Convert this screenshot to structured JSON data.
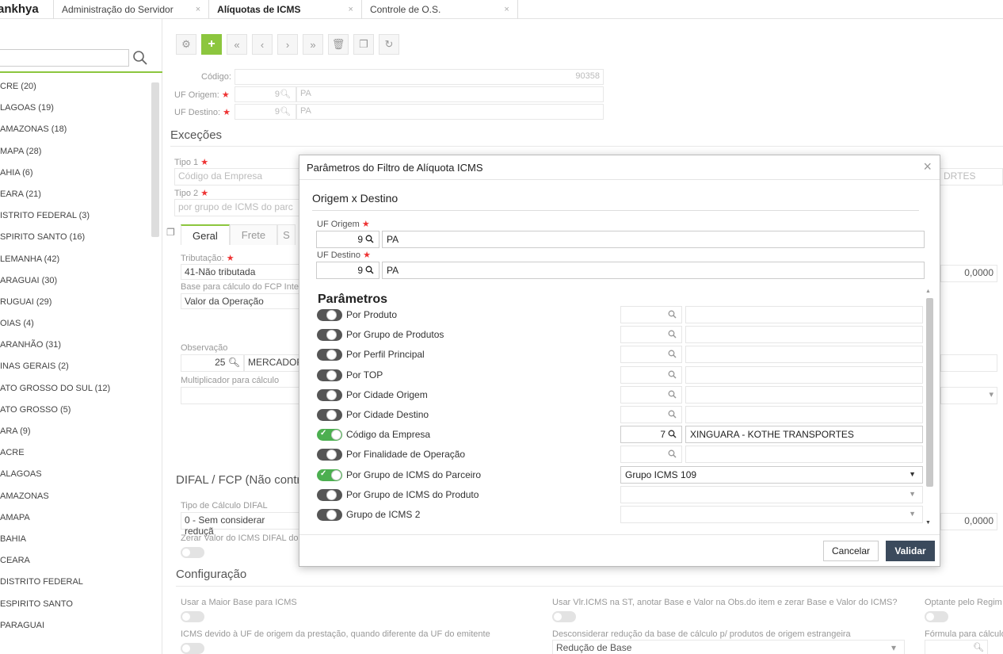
{
  "topbar": {
    "brand": "ankhya",
    "tabs": [
      {
        "label": "Administração do Servidor",
        "close": "×"
      },
      {
        "label": "Alíquotas de ICMS",
        "close": "×"
      },
      {
        "label": "Controle de O.S.",
        "close": "×"
      }
    ]
  },
  "left": {
    "items": [
      "CRE (20)",
      "LAGOAS (19)",
      "AMAZONAS (18)",
      "MAPA (28)",
      "AHIA (6)",
      "EARA (21)",
      "ISTRITO FEDERAL (3)",
      "SPIRITO SANTO (16)",
      "LEMANHA (42)",
      "ARAGUAI (30)",
      "RUGUAI (29)",
      "OIAS (4)",
      "ARANHÃO (31)",
      "INAS GERAIS (2)",
      "ATO GROSSO DO SUL (12)",
      "ATO GROSSO (5)",
      "ARA (9)",
      "ACRE",
      "ALAGOAS",
      "AMAZONAS",
      "AMAPA",
      "BAHIA",
      "CEARA",
      "DISTRITO FEDERAL",
      "ESPIRITO SANTO",
      "PARAGUAI"
    ]
  },
  "form": {
    "codigo_label": "Código:",
    "codigo_value": "90358",
    "uf_origem_label": "UF Origem:",
    "uf_origem_code": "9",
    "uf_origem_name": "PA",
    "uf_destino_label": "UF Destino:",
    "uf_destino_code": "9",
    "uf_destino_name": "PA",
    "excecoes": "Exceções",
    "tipo1_label": "Tipo 1",
    "tipo1_value": "Código da Empresa",
    "tipo1_right": "DRTES",
    "tipo2_label": "Tipo 2",
    "tipo2_value": "por grupo de ICMS do parc",
    "tab_geral": "Geral",
    "tab_frete": "Frete",
    "tab_third": "S",
    "tributacao_label": "Tributação:",
    "tributacao_value": "41-Não tributada",
    "base_fcp_label": "Base para cálculo do FCP Inter",
    "base_fcp_value": "Valor da Operação",
    "right_value1": "0,0000",
    "observacao_label": "Observação",
    "observacao_code": "25",
    "observacao_value": "MERCADOR",
    "multiplicador_label": "Multiplicador para cálculo",
    "difal_title": "DIFAL / FCP (Não contr",
    "tipo_difal_label": "Tipo de Cálculo DIFAL",
    "tipo_difal_value": "0 - Sem considerar reduçã",
    "right_value2": "0,0000",
    "zerar_label": "Zerar Valor do ICMS DIFAL do",
    "configuracao": "Configuração",
    "cfg1_label": "Usar a Maior Base para ICMS",
    "cfg2_label": "Usar Vlr.ICMS na ST, anotar Base e Valor na Obs.do item e zerar Base e Valor do ICMS?",
    "cfg3_label": "Optante pelo Regim",
    "cfg4_label": "ICMS devido à UF de origem da prestação, quando diferente da UF do emitente",
    "cfg5_label": "Desconsiderar redução da base de cálculo p/ produtos de origem estrangeira",
    "cfg5_value": "Redução de Base",
    "cfg6_label": "Fórmula para cálculo"
  },
  "modal": {
    "title": "Parâmetros do Filtro de Alíquota ICMS",
    "close": "×",
    "section": "Origem x Destino",
    "uf_origem_label": "UF Origem",
    "uf_origem_code": "9",
    "uf_origem_name": "PA",
    "uf_destino_label": "UF Destino",
    "uf_destino_code": "9",
    "uf_destino_name": "PA",
    "params_title": "Parâmetros",
    "params": [
      {
        "label": "Por Produto",
        "on": false,
        "kind": "lookup",
        "code": "",
        "name": ""
      },
      {
        "label": "Por Grupo de Produtos",
        "on": false,
        "kind": "lookup",
        "code": "",
        "name": ""
      },
      {
        "label": "Por Perfil Principal",
        "on": false,
        "kind": "lookup",
        "code": "",
        "name": ""
      },
      {
        "label": "Por TOP",
        "on": false,
        "kind": "lookup",
        "code": "",
        "name": ""
      },
      {
        "label": "Por Cidade Origem",
        "on": false,
        "kind": "lookup",
        "code": "",
        "name": ""
      },
      {
        "label": "Por Cidade Destino",
        "on": false,
        "kind": "lookup",
        "code": "",
        "name": ""
      },
      {
        "label": "Código da Empresa",
        "on": true,
        "kind": "lookup",
        "code": "7",
        "name": "XINGUARA - KOTHE TRANSPORTES"
      },
      {
        "label": "Por Finalidade de Operação",
        "on": false,
        "kind": "lookup",
        "code": "",
        "name": ""
      },
      {
        "label": "Por Grupo de ICMS do Parceiro",
        "on": true,
        "kind": "select",
        "value": "Grupo ICMS 109"
      },
      {
        "label": "Por Grupo de ICMS do Produto",
        "on": false,
        "kind": "select",
        "value": ""
      },
      {
        "label": "Grupo de ICMS 2",
        "on": false,
        "kind": "select",
        "value": ""
      }
    ],
    "cancel": "Cancelar",
    "validate": "Validar"
  },
  "colors": {
    "accent_green": "#8cc63e",
    "toggle_on": "#4caf50",
    "primary_dark": "#3b4a5c",
    "required": "#e33333"
  }
}
